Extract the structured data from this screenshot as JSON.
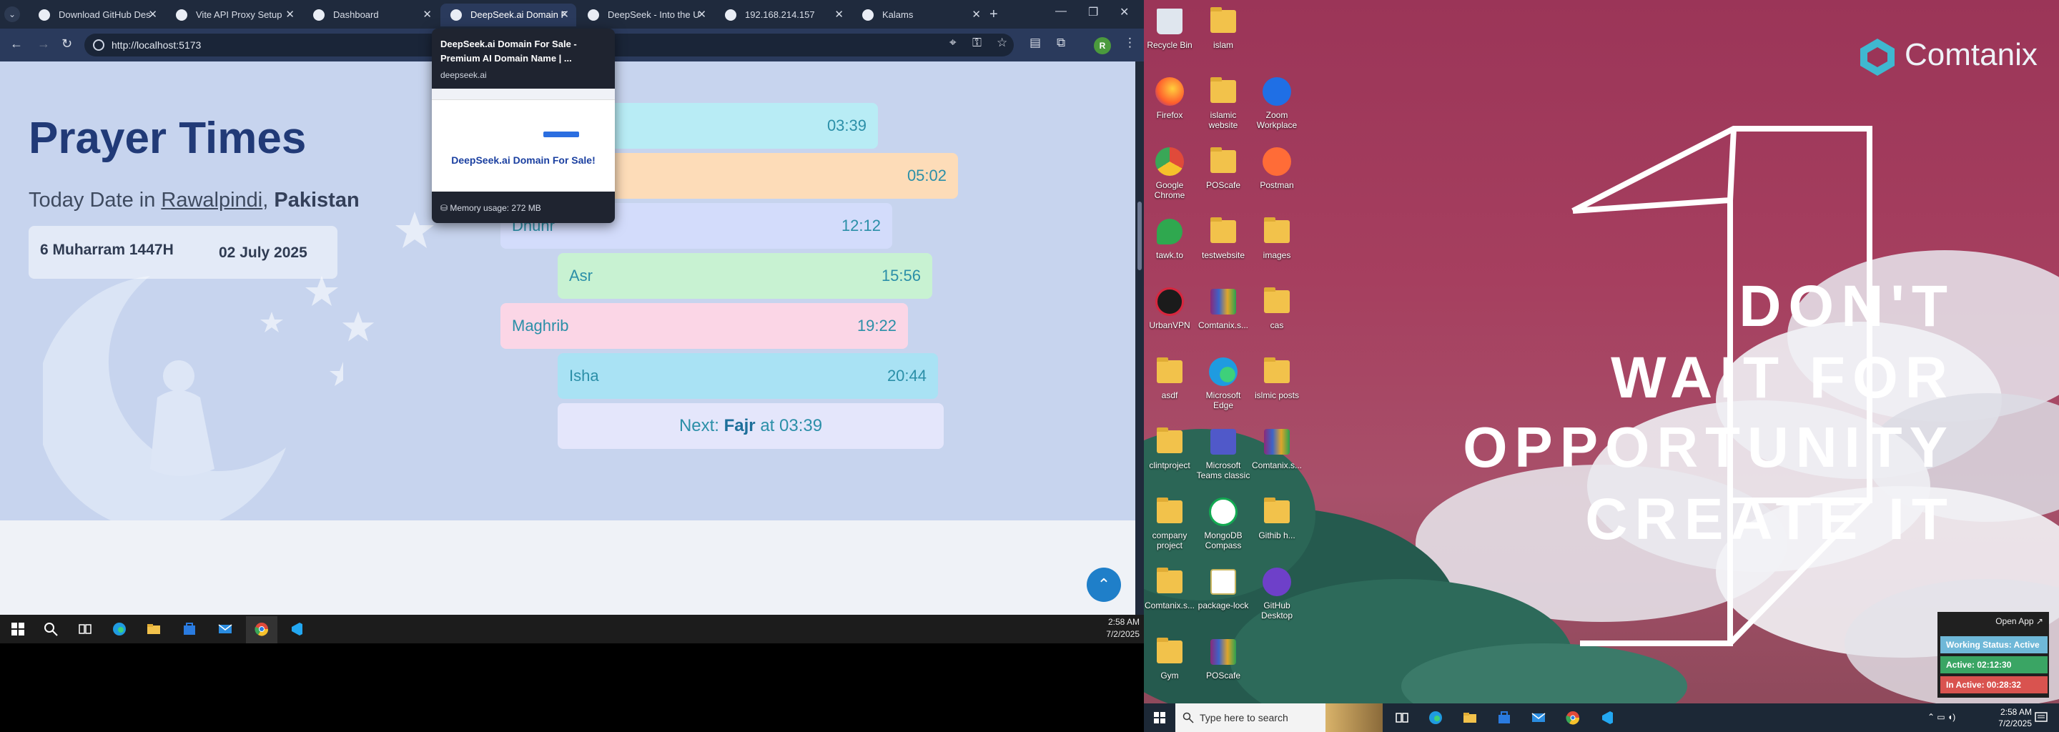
{
  "browser": {
    "tabs": [
      {
        "title": "Download GitHub Des",
        "active": false
      },
      {
        "title": "Vite API Proxy Setup",
        "active": false
      },
      {
        "title": "Dashboard",
        "active": false
      },
      {
        "title": "DeepSeek.ai Domain F",
        "active": true
      },
      {
        "title": "DeepSeek - Into the U",
        "active": false
      },
      {
        "title": "192.168.214.157",
        "active": false
      },
      {
        "title": "Kalams",
        "active": false
      }
    ],
    "url": "http://localhost:5173",
    "profile_initial": "R"
  },
  "tab_hover": {
    "title": "DeepSeek.ai Domain For Sale - Premium AI Domain Name | ...",
    "domain": "deepseek.ai",
    "preview_heading": "DeepSeek.ai Domain For Sale!",
    "memory": "Memory usage: 272 MB"
  },
  "prayer_page": {
    "title": "Prayer Times",
    "date_prefix": "Today Date in",
    "city": "Rawalpindi",
    "separator": ",",
    "country": "Pakistan",
    "hijri_date": "6 Muharram 1447H",
    "gregorian_date": "02 July 2025",
    "prayers": [
      {
        "name": "",
        "time": "03:39",
        "color": "#b8ecf5"
      },
      {
        "name": "",
        "time": "05:02",
        "color": "#fddcb8"
      },
      {
        "name": "Dhuhr",
        "time": "12:12",
        "color": "#d3dcfb"
      },
      {
        "name": "Asr",
        "time": "15:56",
        "color": "#c8f2d2"
      },
      {
        "name": "Maghrib",
        "time": "19:22",
        "color": "#fbd6e6"
      },
      {
        "name": "Isha",
        "time": "20:44",
        "color": "#a9e2f4"
      }
    ],
    "next_prefix": "Next:",
    "next_prayer": "Fajr",
    "next_mid": "at",
    "next_time": "03:39"
  },
  "left_taskbar": {
    "time": "2:58 AM",
    "date": "7/2/2025"
  },
  "desktop": {
    "brand": "Comtanix",
    "quote_lines": [
      "DON'T",
      "WAIT FOR",
      "OPPORTUNITY",
      "CREATE IT"
    ],
    "icons": [
      {
        "label": "Recycle Bin",
        "kind": "bin"
      },
      {
        "label": "islam",
        "kind": "folder"
      },
      {
        "label": "Firefox",
        "kind": "firefox"
      },
      {
        "label": "islamic website",
        "kind": "folder"
      },
      {
        "label": "Zoom Workplace",
        "kind": "zoom"
      },
      {
        "label": "Google Chrome",
        "kind": "chrome"
      },
      {
        "label": "POScafe",
        "kind": "folder"
      },
      {
        "label": "Postman",
        "kind": "postman"
      },
      {
        "label": "tawk.to",
        "kind": "tawk"
      },
      {
        "label": "testwebsite",
        "kind": "folder"
      },
      {
        "label": "images",
        "kind": "folder"
      },
      {
        "label": "UrbanVPN",
        "kind": "vpn"
      },
      {
        "label": "Comtanix.s...",
        "kind": "rar"
      },
      {
        "label": "cas",
        "kind": "folder"
      },
      {
        "label": "asdf",
        "kind": "folder"
      },
      {
        "label": "Microsoft Edge",
        "kind": "edge"
      },
      {
        "label": "islmic posts",
        "kind": "folder"
      },
      {
        "label": "clintproject",
        "kind": "folder"
      },
      {
        "label": "Microsoft Teams classic",
        "kind": "teams"
      },
      {
        "label": "Comtanix.s...",
        "kind": "rar"
      },
      {
        "label": "company project",
        "kind": "folder"
      },
      {
        "label": "MongoDB Compass",
        "kind": "mongo"
      },
      {
        "label": "Githib h...",
        "kind": "folder"
      },
      {
        "label": "Comtanix.s...",
        "kind": "folder"
      },
      {
        "label": "package-lock",
        "kind": "json"
      },
      {
        "label": "GitHub Desktop",
        "kind": "github"
      },
      {
        "label": "Gym",
        "kind": "folder"
      },
      {
        "label": "POScafe",
        "kind": "rar"
      }
    ]
  },
  "widget": {
    "open_label": "Open App ↗",
    "status": "Working Status: Active",
    "active": "Active: 02:12:30",
    "inactive": "In Active: 00:28:32",
    "colors": {
      "status": "#6fb8d8",
      "active": "#3aa564",
      "inactive": "#d9534f"
    }
  },
  "right_taskbar": {
    "search_placeholder": "Type here to search",
    "time": "2:58 AM",
    "date": "7/2/2025"
  }
}
